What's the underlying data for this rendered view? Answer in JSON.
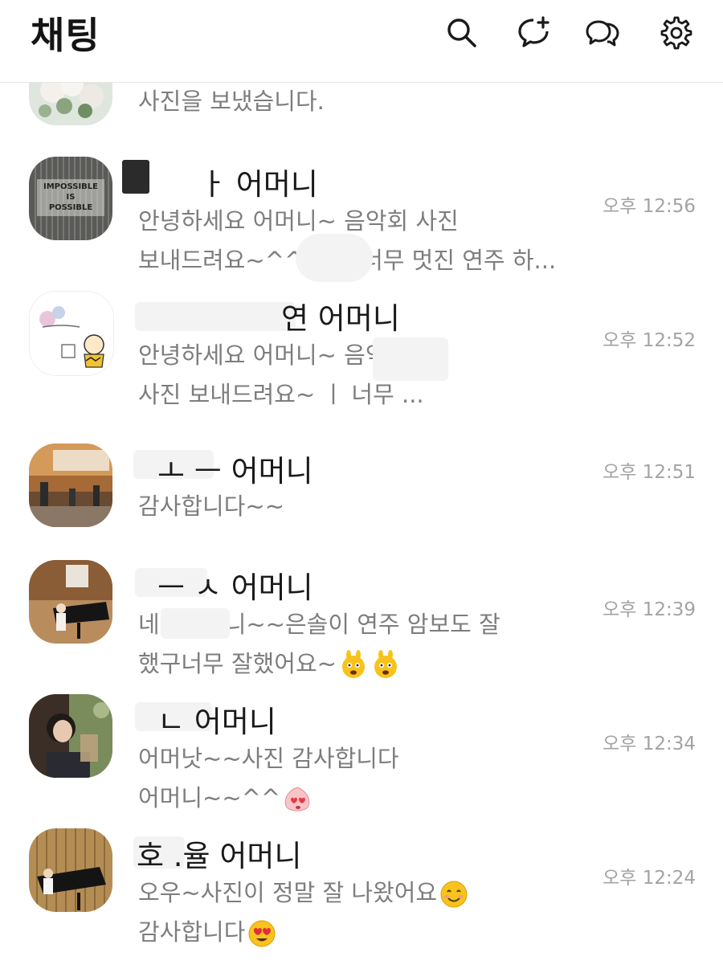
{
  "header": {
    "title": "채팅",
    "icons": [
      "search-icon",
      "new-chat-icon",
      "open-chat-icon",
      "settings-icon"
    ]
  },
  "chats": [
    {
      "name": "",
      "preview_lines": [
        "사진을 보냈습니다."
      ],
      "time": ""
    },
    {
      "name": "ㅏ 어머니",
      "preview_lines": [
        "안녕하세요 어머니~             음악회 사진",
        "보내드려요~^^ㄱ       ㅣ 너무 멋진 연주 하..."
      ],
      "time": "오후 12:56"
    },
    {
      "name": "연 어머니",
      "preview_lines": [
        "안녕하세요 어머니~                           음악회",
        "사진 보내드려요~                           ㅣ 너무 ..."
      ],
      "time": "오후 12:52"
    },
    {
      "name": "ㅗ ㅡ 어머니",
      "preview_lines": [
        "감사합니다~~"
      ],
      "time": "오후 12:51"
    },
    {
      "name": "ㅡ ㅅ 어머니",
      "preview_lines": [
        "네           , 어머니~~은솔이 연주 암보도 잘",
        "했구너무 잘했어요~"
      ],
      "time": "오후 12:39"
    },
    {
      "name": "ㄴ 어머니",
      "preview_lines": [
        "어머낫~~사진 감사합니다",
        "어머니~~^^"
      ],
      "time": "오후 12:34"
    },
    {
      "name": "호  .율 어머니",
      "preview_lines": [
        "오우~사진이 정말 잘 나왔어요",
        "감사합니다"
      ],
      "time": "오후 12:24"
    }
  ],
  "avatar_texts": {
    "impossible": [
      "IMPOSSIBLE",
      "IS",
      "POSSIBLE"
    ]
  }
}
